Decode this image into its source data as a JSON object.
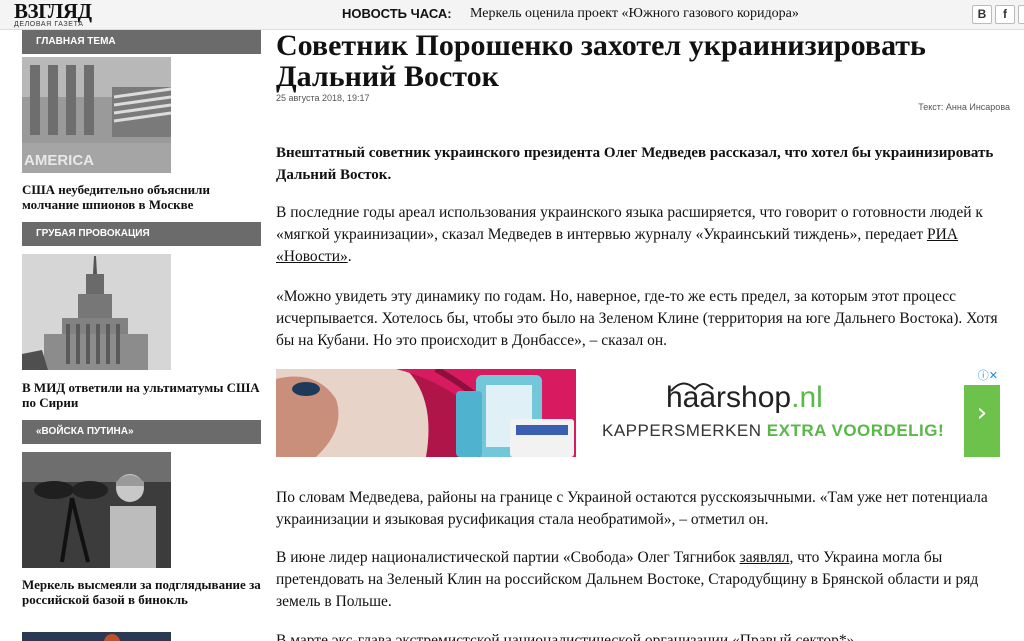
{
  "topbar": {
    "logo": "ВЗГЛЯД",
    "logo_subtitle": "ДЕЛОВАЯ ГАЗЕТА",
    "news_hour_label": "НОВОСТЬ ЧАСА:",
    "news_hour_text": "Меркель оценила проект «Южного газового коридора»",
    "social": [
      "В",
      "f",
      "g"
    ]
  },
  "sidebar": {
    "sections": [
      {
        "header": "Главная тема",
        "image": "america-embassy-photo",
        "title": "США неубедительно объяснили молчание шпионов в Москве"
      },
      {
        "header": "Грубая провокация",
        "image": "mid-building-photo",
        "title": "В МИД ответили на ультиматумы США по Сирии"
      },
      {
        "header": "«Войска Путина»",
        "image": "merkel-binoculars-photo",
        "title": "Меркель высмеяли за подглядывание за российской базой в бинокль"
      }
    ]
  },
  "article": {
    "title": "Советник Порошенко захотел украинизировать Дальний Восток",
    "date": "25 августа 2018, 19:17",
    "author": "Текст: Анна Инсарова",
    "lead": "Внештатный советник украинского президента Олег Медведев рассказал, что хотел бы украинизировать Дальний Восток.",
    "p1_before": "В последние годы ареал использования украинского языка расширяется, что говорит о готовности людей к «мягкой украинизации», сказал Медведев в интервью журналу «Украинський тиждень», передает ",
    "p1_link": "РИА «Новости»",
    "p1_after": ".",
    "p2": "«Можно увидеть эту динамику по годам. Но, наверное, где-то же есть предел, за которым этот процесс исчерпывается. Хотелось бы, чтобы это было на Зеленом Клине (территория на юге Дальнего Востока). Хотя бы на Кубани. Но это происходит в Донбассе», – сказал он.",
    "p3": "По словам Медведева, районы на границе с Украиной остаются русскоязычными. «Там уже нет потенциала украинизации и языковая русификация стала необратимой», – отметил он.",
    "p4_before": "В июне лидер националистической партии «Свобода» Олег Тягнибок ",
    "p4_link": "заявлял",
    "p4_after": ", что Украина могла бы претендовать на Зеленый Клин на российском Дальнем Востоке, Стародубщину в Брянской области и ряд земель в Польше.",
    "p5": "В марте экс-глава экстремистской националистической организации «Правый сектор*»"
  },
  "ad": {
    "brand_main": "haarshop",
    "brand_tld": ".nl",
    "slogan_a": "KAPPERSMERKEN ",
    "slogan_b": "EXTRA VOORDELIG!",
    "arrow": "›",
    "corner": "ⓘ✕",
    "colors": {
      "green": "#6dc24b",
      "hair": "#c2185b"
    }
  }
}
